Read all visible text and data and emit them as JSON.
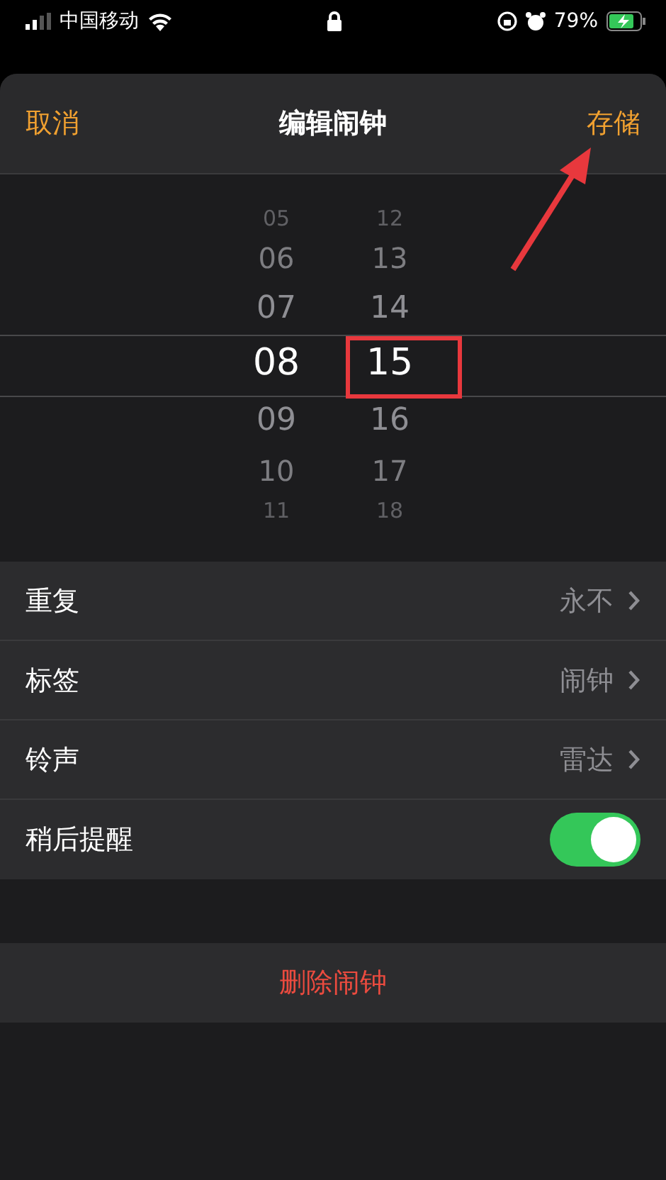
{
  "status_bar": {
    "carrier": "中国移动",
    "battery": "79%"
  },
  "header": {
    "cancel": "取消",
    "title": "编辑闹钟",
    "save": "存储"
  },
  "picker": {
    "columns": [
      {
        "items": [
          {
            "value": "05",
            "selected": false
          },
          {
            "value": "06",
            "selected": false
          },
          {
            "value": "07",
            "selected": false
          },
          {
            "value": "08",
            "selected": true
          },
          {
            "value": "09",
            "selected": false
          },
          {
            "value": "10",
            "selected": false
          },
          {
            "value": "11",
            "selected": false
          }
        ]
      },
      {
        "items": [
          {
            "value": "12",
            "selected": false
          },
          {
            "value": "13",
            "selected": false
          },
          {
            "value": "14",
            "selected": false
          },
          {
            "value": "15",
            "selected": true
          },
          {
            "value": "16",
            "selected": false
          },
          {
            "value": "17",
            "selected": false
          },
          {
            "value": "18",
            "selected": false
          }
        ]
      }
    ]
  },
  "settings": [
    {
      "kind": "link",
      "label": "重复",
      "value": "永不"
    },
    {
      "kind": "link",
      "label": "标签",
      "value": "闹钟"
    },
    {
      "kind": "link",
      "label": "铃声",
      "value": "雷达"
    },
    {
      "kind": "toggle",
      "label": "稍后提醒",
      "on": true
    }
  ],
  "delete_button": "删除闹钟",
  "annotations": {
    "highlight": true,
    "arrow": true
  }
}
